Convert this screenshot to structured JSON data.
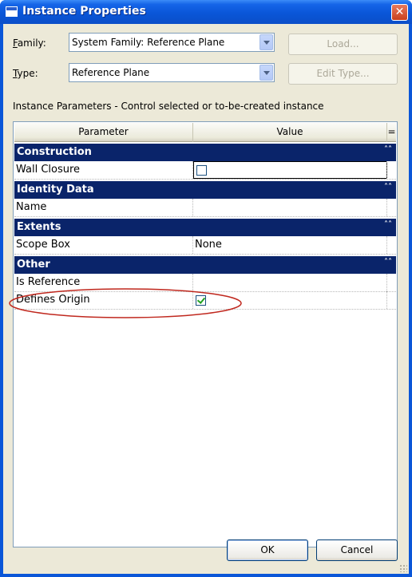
{
  "window": {
    "title": "Instance Properties",
    "close_glyph": "✕"
  },
  "family": {
    "label_mnemonic": "F",
    "label_rest": "amily:",
    "value": "System Family: Reference Plane",
    "load_button": "Load..."
  },
  "type": {
    "label_mnemonic": "T",
    "label_rest": "ype:",
    "value": "Reference Plane",
    "edit_type_button": "Edit Type..."
  },
  "instance_caption": "Instance Parameters - Control selected or to-be-created instance",
  "grid": {
    "col_parameter": "Parameter",
    "col_value": "Value",
    "col_extra": "=",
    "groups": [
      {
        "name": "Construction",
        "rows": [
          {
            "name": "Wall Closure",
            "value": "",
            "checkbox": "unchecked",
            "editing": true
          }
        ]
      },
      {
        "name": "Identity Data",
        "rows": [
          {
            "name": "Name",
            "value": ""
          }
        ]
      },
      {
        "name": "Extents",
        "rows": [
          {
            "name": "Scope Box",
            "value": "None"
          }
        ]
      },
      {
        "name": "Other",
        "rows": [
          {
            "name": "Is Reference",
            "value": ""
          },
          {
            "name": "Defines Origin",
            "value": "",
            "checkbox": "checked"
          }
        ]
      }
    ],
    "collapse_glyph": "˄˄"
  },
  "buttons": {
    "ok": "OK",
    "cancel": "Cancel"
  },
  "colors": {
    "group_header": "#0a246a",
    "highlight_ellipse": "#c0281e",
    "titlebar": "#0a56d8"
  }
}
